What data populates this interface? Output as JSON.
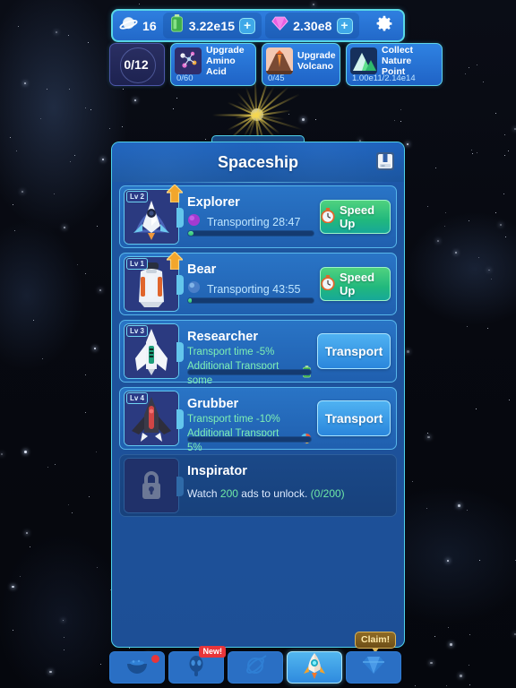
{
  "topbar": {
    "planet_icon": "planet-icon",
    "planet_count": "16",
    "battery_icon": "battery-icon",
    "battery_value": "3.22e15",
    "battery_plus": "+",
    "gem_icon": "gem-icon",
    "gem_value": "2.30e8",
    "gem_plus": "+",
    "settings_icon": "gear-icon"
  },
  "quests": {
    "counter": "0/12",
    "items": [
      {
        "icon": "amino-acid-icon",
        "title_line1": "Upgrade",
        "title_line2": "Amino Acid",
        "progress": "0/60"
      },
      {
        "icon": "volcano-icon",
        "title_line1": "Upgrade",
        "title_line2": "Volcano",
        "progress": "0/45"
      },
      {
        "icon": "mountain-icon",
        "title_line1": "Collect",
        "title_line2": "Nature Point",
        "progress": "1.00e11/2.14e14"
      }
    ]
  },
  "panel": {
    "title": "Spaceship",
    "journal_icon": "journal-icon"
  },
  "ships": [
    {
      "name": "Explorer",
      "level": "Lv 2",
      "thumb": "explorer-ship-icon",
      "state": "transporting",
      "resource_icon": "purple-planet-icon",
      "status": "Transporting 28:47",
      "progress_percent": 4,
      "action_label": "Speed Up",
      "action_icon": "stopwatch-icon",
      "action_type": "speed-up"
    },
    {
      "name": "Bear",
      "level": "Lv 1",
      "thumb": "bear-ship-icon",
      "state": "transporting",
      "resource_icon": "blue-planet-icon",
      "status": "Transporting 43:55",
      "progress_percent": 3,
      "action_label": "Speed Up",
      "action_icon": "stopwatch-icon",
      "action_type": "speed-up"
    },
    {
      "name": "Researcher",
      "level": "Lv 3",
      "thumb": "researcher-ship-icon",
      "state": "idle",
      "perk1": "Transport time -5%",
      "perk2": "Additional Transport some",
      "perk2_icon": "battery-icon",
      "progress_percent": 0,
      "action_label": "Transport",
      "action_type": "transport"
    },
    {
      "name": "Grubber",
      "level": "Lv 4",
      "thumb": "grubber-ship-icon",
      "state": "idle",
      "perk1": "Transport time -10%",
      "perk2": "Additional Transport 5%",
      "perk2_icon": "multicolor-planet-icon",
      "progress_percent": 0,
      "action_label": "Transport",
      "action_type": "transport"
    },
    {
      "name": "Inspirator",
      "thumb": "lock-icon",
      "state": "locked",
      "lock_prefix": "Watch ",
      "lock_count": "200",
      "lock_mid": " ads to unlock. ",
      "lock_progress": "(0/200)"
    }
  ],
  "bottomnav": {
    "items": [
      {
        "icon": "food-bowl-icon",
        "active": false,
        "notify_dot": true
      },
      {
        "icon": "alien-icon",
        "active": false,
        "badge": "New!"
      },
      {
        "icon": "atom-icon",
        "active": false
      },
      {
        "icon": "rocket-icon",
        "active": true
      },
      {
        "icon": "diamond-icon",
        "active": false
      }
    ],
    "claim_label": "Claim!"
  }
}
